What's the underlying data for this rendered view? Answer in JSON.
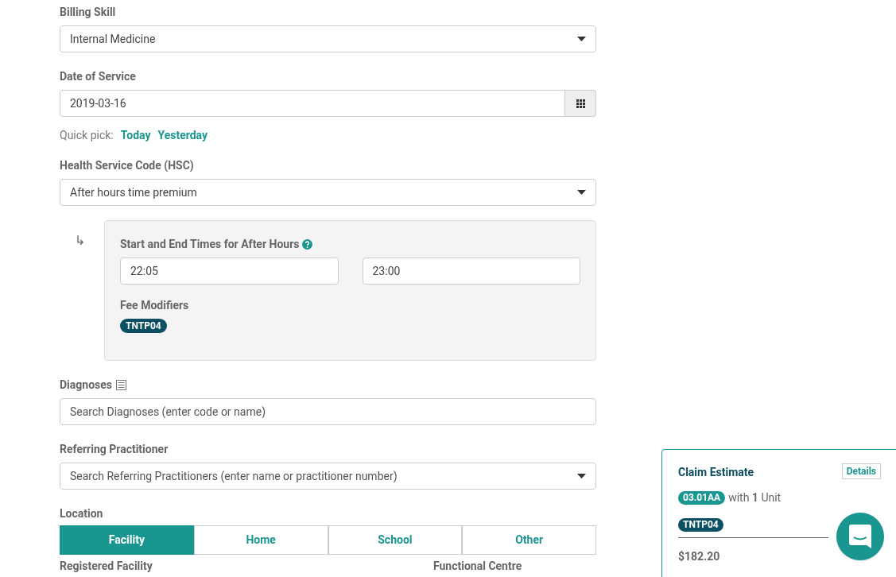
{
  "billing_skill": {
    "label": "Billing Skill",
    "value": "Internal Medicine"
  },
  "date_of_service": {
    "label": "Date of Service",
    "value": "2019-03-16",
    "quick_pick_label": "Quick pick:",
    "quick_picks": [
      "Today",
      "Yesterday"
    ]
  },
  "hsc": {
    "label": "Health Service Code (HSC)",
    "value": "After hours time premium"
  },
  "after_hours": {
    "arrow": "↳",
    "label": "Start and End Times for After Hours",
    "start": "22:05",
    "end": "23:00",
    "fee_modifiers_label": "Fee Modifiers",
    "fee_modifiers": [
      "TNTP04"
    ]
  },
  "diagnoses": {
    "label": "Diagnoses",
    "placeholder": "Search Diagnoses (enter code or name)"
  },
  "referring_practitioner": {
    "label": "Referring Practitioner",
    "placeholder": "Search Referring Practitioners (enter name or practitioner number)"
  },
  "location": {
    "label": "Location",
    "options": [
      {
        "label": "Facility",
        "selected": true
      },
      {
        "label": "Home",
        "selected": false
      },
      {
        "label": "School",
        "selected": false
      },
      {
        "label": "Other",
        "selected": false
      }
    ]
  },
  "next_fields": [
    "Registered Facility",
    "Functional Centre"
  ],
  "claim_estimate": {
    "title": "Claim Estimate",
    "details": "Details",
    "code": "03.01AA",
    "units": "with **1** Unit",
    "modifiers": [
      "TNTP04"
    ],
    "total": "$182.20"
  }
}
